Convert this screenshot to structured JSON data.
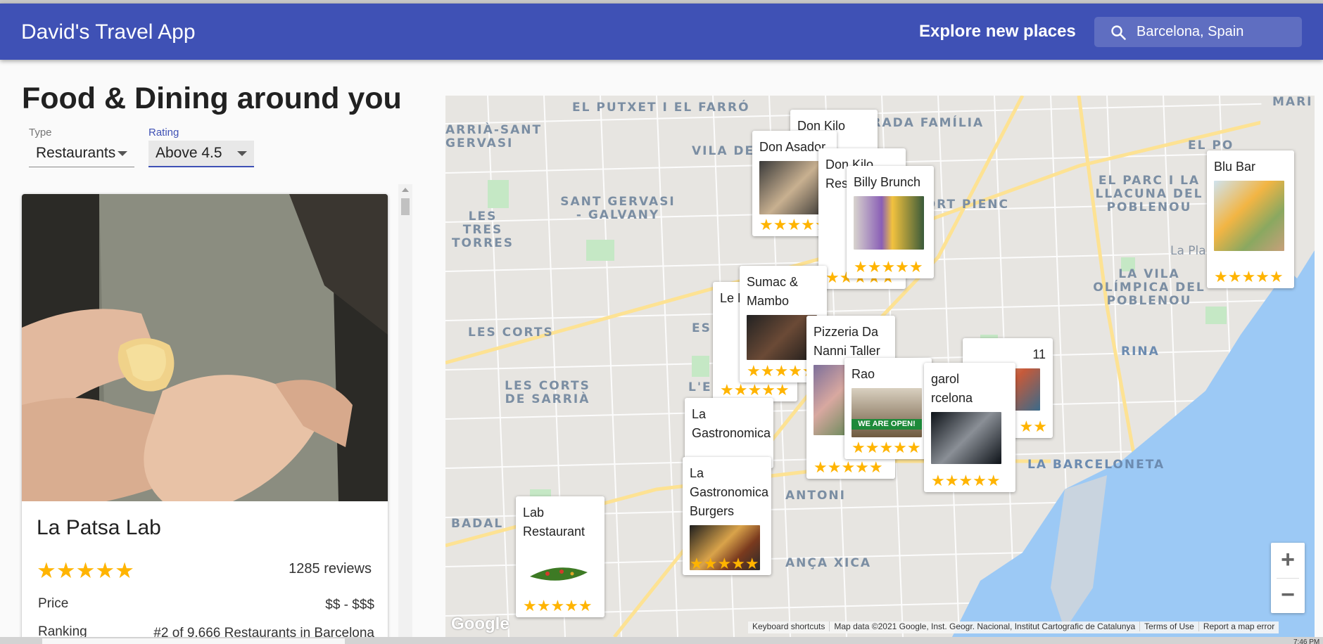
{
  "header": {
    "app_title": "David's Travel App",
    "explore_label": "Explore new places",
    "search_value": "Barcelona, Spain",
    "color": "#3f51b5"
  },
  "main": {
    "title": "Food & Dining around you",
    "type_filter": {
      "label": "Type",
      "value": "Restaurants"
    },
    "rating_filter": {
      "label": "Rating",
      "value": "Above 4.5"
    }
  },
  "card": {
    "name": "La Patsa Lab",
    "rating": 5,
    "stars": "★★★★★",
    "reviews": "1285 reviews",
    "price_label": "Price",
    "price_value": "$$ - $$$",
    "ranking_label": "Ranking",
    "ranking_value": "#2 of 9,666 Restaurants in Barcelona"
  },
  "map": {
    "labels": [
      "EL PUTXET I EL FARRÓ",
      "SAGRADA FAMÍLIA",
      "ARRIÀ-SANT GERVASI",
      "VILA DE",
      "SANT GERVASI - GALVANY",
      "LES TRES TORRES",
      "FORT PIENC",
      "EL PARC I LA LLACUNA DEL POBLENOU",
      "LA VILA OLÍMPICA DEL POBLENOU",
      "La Pla",
      "MARÍ",
      "EL PO",
      "LES CORTS",
      "LES CORTS DE SARRIÀ",
      "ES",
      "L'E",
      "ANTONI",
      "BADAL",
      "ANÇA XICA",
      "LA BARCELONETA",
      "RINA"
    ],
    "places": [
      {
        "name": "Don Kilo",
        "stars": "★★★★★"
      },
      {
        "name": "Don Asador",
        "stars": "★★★★★"
      },
      {
        "name": "Don Kilo Res",
        "stars": "★★★★★"
      },
      {
        "name": "Billy Brunch",
        "stars": "★★★★★"
      },
      {
        "name": "Blu Bar",
        "stars": "★★★★★"
      },
      {
        "name": "Le F",
        "stars": "★★★★★"
      },
      {
        "name": "Sumac & Mambo",
        "stars": "★★★★★"
      },
      {
        "name": "Pizzeria Da Nanni Taller",
        "stars": "★★★★★"
      },
      {
        "name": "Rao",
        "stars": "★★★★★",
        "image_text": "WE ARE OPEN!"
      },
      {
        "name": "11",
        "stars": "★★"
      },
      {
        "name": "garol rcelona",
        "stars": "★★★★★"
      },
      {
        "name": "La Gastronomica",
        "stars": ""
      },
      {
        "name": "La Gastronomica Burgers",
        "stars": "★★★★★"
      },
      {
        "name": "Lab Restaurant",
        "stars": "★★★★★"
      }
    ],
    "zoom_in": "+",
    "zoom_out": "−",
    "footer": [
      "Keyboard shortcuts",
      "Map data ©2021 Google, Inst. Geogr. Nacional, Institut Cartografic de Catalunya",
      "Terms of Use",
      "Report a map error"
    ],
    "logo": "Google"
  },
  "taskbar": {
    "clock": "7:46 PM"
  }
}
